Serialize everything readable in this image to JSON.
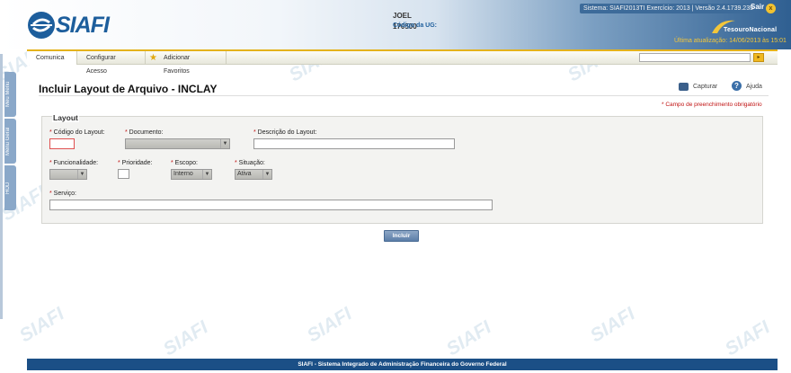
{
  "header": {
    "logo_text": "SIAFI",
    "user_name": "JOEL",
    "ug_label": "Código da UG:",
    "ug_value": "170500",
    "system_info": "Sistema: SIAFI2013TI Exercício: 2013 | Versão 2.4.1739.235",
    "logout_label": "Sair",
    "treasury_text": "TesouroNacional",
    "last_update": "Última atualização: 14/06/2013 às 15:01"
  },
  "menubar": {
    "items": [
      "Comunica",
      "Configurar Acesso",
      "Adicionar Favoritos"
    ],
    "search_value": ""
  },
  "sidebar": {
    "tabs": [
      "Meu Menu",
      "Menu Geral",
      "HOD"
    ]
  },
  "page": {
    "title": "Incluir Layout de Arquivo - INCLAY",
    "capturar_label": "Capturar",
    "ajuda_label": "Ajuda",
    "required_note": "* Campo de preenchimento obrigatório"
  },
  "form": {
    "legend": "Layout",
    "codigo_label": "Código do Layout:",
    "codigo_value": "",
    "documento_label": "Documento:",
    "documento_value": "",
    "descricao_label": "Descrição do Layout:",
    "descricao_value": "",
    "funcionalidade_label": "Funcionalidade:",
    "funcionalidade_value": "",
    "prioridade_label": "Prioridade:",
    "escopo_label": "Escopo:",
    "escopo_value": "Interno",
    "situacao_label": "Situação:",
    "situacao_value": "Ativa",
    "servico_label": "Serviço:",
    "servico_value": "",
    "submit_label": "Incluir"
  },
  "footer": {
    "text": "SIAFI - Sistema Integrado de Administração Financeira do Governo Federal"
  },
  "colors": {
    "brand_blue": "#1d5e9c",
    "footer_blue": "#1b4f86",
    "accent_yellow": "#e4b21c",
    "required_red": "#c01010"
  }
}
